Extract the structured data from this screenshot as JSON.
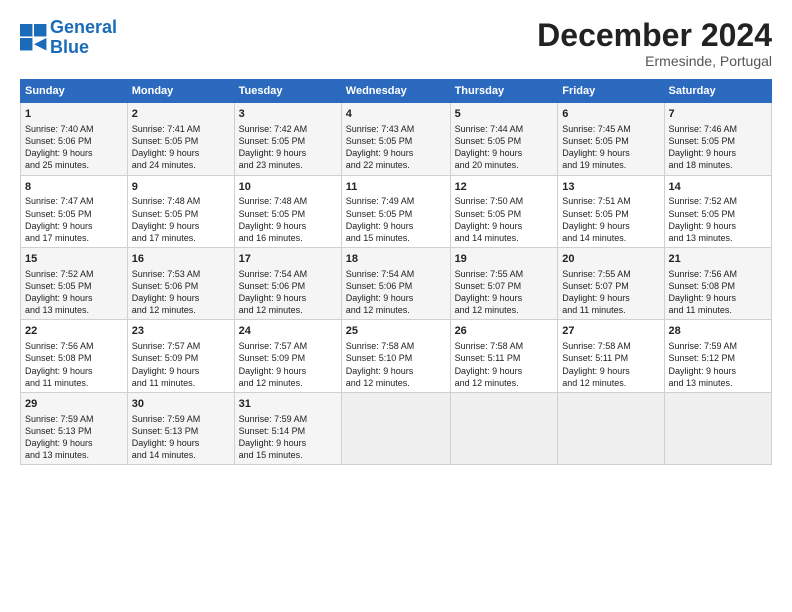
{
  "logo": {
    "line1": "General",
    "line2": "Blue"
  },
  "header": {
    "title": "December 2024",
    "subtitle": "Ermesinde, Portugal"
  },
  "weekdays": [
    "Sunday",
    "Monday",
    "Tuesday",
    "Wednesday",
    "Thursday",
    "Friday",
    "Saturday"
  ],
  "weeks": [
    [
      {
        "day": "1",
        "lines": [
          "Sunrise: 7:40 AM",
          "Sunset: 5:06 PM",
          "Daylight: 9 hours",
          "and 25 minutes."
        ]
      },
      {
        "day": "2",
        "lines": [
          "Sunrise: 7:41 AM",
          "Sunset: 5:05 PM",
          "Daylight: 9 hours",
          "and 24 minutes."
        ]
      },
      {
        "day": "3",
        "lines": [
          "Sunrise: 7:42 AM",
          "Sunset: 5:05 PM",
          "Daylight: 9 hours",
          "and 23 minutes."
        ]
      },
      {
        "day": "4",
        "lines": [
          "Sunrise: 7:43 AM",
          "Sunset: 5:05 PM",
          "Daylight: 9 hours",
          "and 22 minutes."
        ]
      },
      {
        "day": "5",
        "lines": [
          "Sunrise: 7:44 AM",
          "Sunset: 5:05 PM",
          "Daylight: 9 hours",
          "and 20 minutes."
        ]
      },
      {
        "day": "6",
        "lines": [
          "Sunrise: 7:45 AM",
          "Sunset: 5:05 PM",
          "Daylight: 9 hours",
          "and 19 minutes."
        ]
      },
      {
        "day": "7",
        "lines": [
          "Sunrise: 7:46 AM",
          "Sunset: 5:05 PM",
          "Daylight: 9 hours",
          "and 18 minutes."
        ]
      }
    ],
    [
      {
        "day": "8",
        "lines": [
          "Sunrise: 7:47 AM",
          "Sunset: 5:05 PM",
          "Daylight: 9 hours",
          "and 17 minutes."
        ]
      },
      {
        "day": "9",
        "lines": [
          "Sunrise: 7:48 AM",
          "Sunset: 5:05 PM",
          "Daylight: 9 hours",
          "and 17 minutes."
        ]
      },
      {
        "day": "10",
        "lines": [
          "Sunrise: 7:48 AM",
          "Sunset: 5:05 PM",
          "Daylight: 9 hours",
          "and 16 minutes."
        ]
      },
      {
        "day": "11",
        "lines": [
          "Sunrise: 7:49 AM",
          "Sunset: 5:05 PM",
          "Daylight: 9 hours",
          "and 15 minutes."
        ]
      },
      {
        "day": "12",
        "lines": [
          "Sunrise: 7:50 AM",
          "Sunset: 5:05 PM",
          "Daylight: 9 hours",
          "and 14 minutes."
        ]
      },
      {
        "day": "13",
        "lines": [
          "Sunrise: 7:51 AM",
          "Sunset: 5:05 PM",
          "Daylight: 9 hours",
          "and 14 minutes."
        ]
      },
      {
        "day": "14",
        "lines": [
          "Sunrise: 7:52 AM",
          "Sunset: 5:05 PM",
          "Daylight: 9 hours",
          "and 13 minutes."
        ]
      }
    ],
    [
      {
        "day": "15",
        "lines": [
          "Sunrise: 7:52 AM",
          "Sunset: 5:05 PM",
          "Daylight: 9 hours",
          "and 13 minutes."
        ]
      },
      {
        "day": "16",
        "lines": [
          "Sunrise: 7:53 AM",
          "Sunset: 5:06 PM",
          "Daylight: 9 hours",
          "and 12 minutes."
        ]
      },
      {
        "day": "17",
        "lines": [
          "Sunrise: 7:54 AM",
          "Sunset: 5:06 PM",
          "Daylight: 9 hours",
          "and 12 minutes."
        ]
      },
      {
        "day": "18",
        "lines": [
          "Sunrise: 7:54 AM",
          "Sunset: 5:06 PM",
          "Daylight: 9 hours",
          "and 12 minutes."
        ]
      },
      {
        "day": "19",
        "lines": [
          "Sunrise: 7:55 AM",
          "Sunset: 5:07 PM",
          "Daylight: 9 hours",
          "and 12 minutes."
        ]
      },
      {
        "day": "20",
        "lines": [
          "Sunrise: 7:55 AM",
          "Sunset: 5:07 PM",
          "Daylight: 9 hours",
          "and 11 minutes."
        ]
      },
      {
        "day": "21",
        "lines": [
          "Sunrise: 7:56 AM",
          "Sunset: 5:08 PM",
          "Daylight: 9 hours",
          "and 11 minutes."
        ]
      }
    ],
    [
      {
        "day": "22",
        "lines": [
          "Sunrise: 7:56 AM",
          "Sunset: 5:08 PM",
          "Daylight: 9 hours",
          "and 11 minutes."
        ]
      },
      {
        "day": "23",
        "lines": [
          "Sunrise: 7:57 AM",
          "Sunset: 5:09 PM",
          "Daylight: 9 hours",
          "and 11 minutes."
        ]
      },
      {
        "day": "24",
        "lines": [
          "Sunrise: 7:57 AM",
          "Sunset: 5:09 PM",
          "Daylight: 9 hours",
          "and 12 minutes."
        ]
      },
      {
        "day": "25",
        "lines": [
          "Sunrise: 7:58 AM",
          "Sunset: 5:10 PM",
          "Daylight: 9 hours",
          "and 12 minutes."
        ]
      },
      {
        "day": "26",
        "lines": [
          "Sunrise: 7:58 AM",
          "Sunset: 5:11 PM",
          "Daylight: 9 hours",
          "and 12 minutes."
        ]
      },
      {
        "day": "27",
        "lines": [
          "Sunrise: 7:58 AM",
          "Sunset: 5:11 PM",
          "Daylight: 9 hours",
          "and 12 minutes."
        ]
      },
      {
        "day": "28",
        "lines": [
          "Sunrise: 7:59 AM",
          "Sunset: 5:12 PM",
          "Daylight: 9 hours",
          "and 13 minutes."
        ]
      }
    ],
    [
      {
        "day": "29",
        "lines": [
          "Sunrise: 7:59 AM",
          "Sunset: 5:13 PM",
          "Daylight: 9 hours",
          "and 13 minutes."
        ]
      },
      {
        "day": "30",
        "lines": [
          "Sunrise: 7:59 AM",
          "Sunset: 5:13 PM",
          "Daylight: 9 hours",
          "and 14 minutes."
        ]
      },
      {
        "day": "31",
        "lines": [
          "Sunrise: 7:59 AM",
          "Sunset: 5:14 PM",
          "Daylight: 9 hours",
          "and 15 minutes."
        ]
      },
      null,
      null,
      null,
      null
    ]
  ]
}
